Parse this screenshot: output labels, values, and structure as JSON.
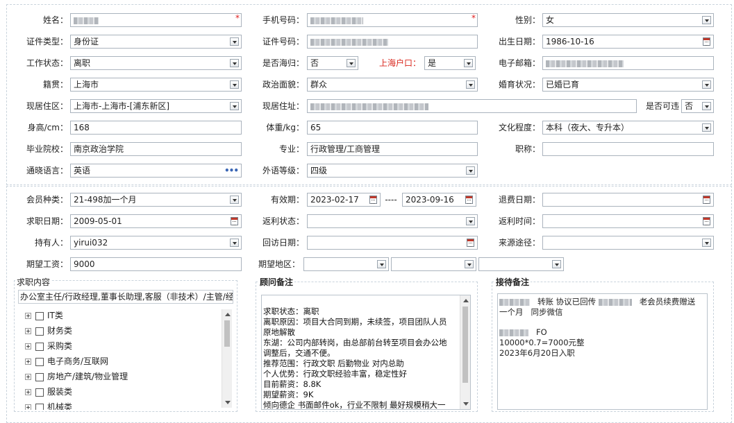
{
  "basic": {
    "name_label": "姓名：",
    "phone_label": "手机号码：",
    "gender_label": "性别：",
    "gender_value": "女",
    "id_type_label": "证件类型：",
    "id_type_value": "身份证",
    "id_no_label": "证件号码：",
    "birth_label": "出生日期：",
    "birth_value": "1986-10-16",
    "work_status_label": "工作状态：",
    "work_status_value": "离职",
    "overseas_label": "是否海归：",
    "overseas_value": "否",
    "shanghai_hukou_label": "上海户口：",
    "shanghai_hukou_value": "是",
    "email_label": "电子邮箱：",
    "native_label": "籍贯：",
    "native_value": "上海市",
    "political_label": "政治面貌：",
    "political_value": "群众",
    "marital_label": "婚育状况：",
    "marital_value": "已婚已育",
    "residence_area_label": "现居住区：",
    "residence_area_value": "上海市-上海市-[浦东新区]",
    "residence_addr_label": "现居住址：",
    "visitable_label": "是否可违",
    "visitable_value": "否",
    "height_label": "身高/cm：",
    "height_value": "168",
    "weight_label": "体重/kg：",
    "weight_value": "65",
    "education_label": "文化程度：",
    "education_value": "本科（夜大、专升本）",
    "school_label": "毕业院校：",
    "school_value": "南京政治学院",
    "major_label": "专业：",
    "major_value": "行政管理/工商管理",
    "title_label": "职称：",
    "language_label": "通晓语言：",
    "language_value": "英语",
    "lang_level_label": "外语等级：",
    "lang_level_value": "四级"
  },
  "member": {
    "type_label": "会员种类：",
    "type_value": "21-498加一个月",
    "valid_label": "有效期：",
    "valid_from": "2023-02-17",
    "valid_sep": "----",
    "valid_to": "2023-09-16",
    "refund_date_label": "退费日期：",
    "job_date_label": "求职日期：",
    "job_date_value": "2009-05-01",
    "rebate_status_label": "返利状态：",
    "rebate_time_label": "返利时间：",
    "holder_label": "持有人：",
    "holder_value": "yirui032",
    "visit_date_label": "回访日期：",
    "source_label": "来源途径：",
    "salary_label": "期望工资：",
    "salary_value": "9000",
    "region_label": "期望地区："
  },
  "job_content": {
    "title": "求职内容",
    "summary": "办公室主任/行政经理,董事长助理,客服（非技术）/主管/经",
    "tree": [
      "IT类",
      "财务类",
      "采购类",
      "电子商务/互联网",
      "房地产/建筑/物业管理",
      "服装类",
      "机械类"
    ]
  },
  "advisor_notes": {
    "title": "顾问备注",
    "text": "求职状态：离职\n离职原因：项目大合同到期，未续签，项目团队人员\n原地解散\n东湖：公司内部转岗，由总部前台转至项目会办公地\n调整后，交通不便。\n推荐范围：行政文职 后勤物业 对内总助\n个人优势：行政文职经验丰富，稳定性好\n目前薪资：8.8K\n期望薪资：9K\n倾向德企 书面邮件ok，行业不限制 最好规模稍大一"
  },
  "reception_notes": {
    "title": "接待备注",
    "line1a": "转账  协议已回传",
    "line1b": "老会员续费赠送",
    "line2": "一个月   同步微信",
    "line3": "FO",
    "line4": "10000*0.7=7000元整",
    "line5": "2023年6月20日入职"
  },
  "colors": {
    "border": "#aab3bd",
    "required": "#e02020",
    "hukou_label": "#d9261c",
    "ellipsis": "#3a66b5"
  }
}
